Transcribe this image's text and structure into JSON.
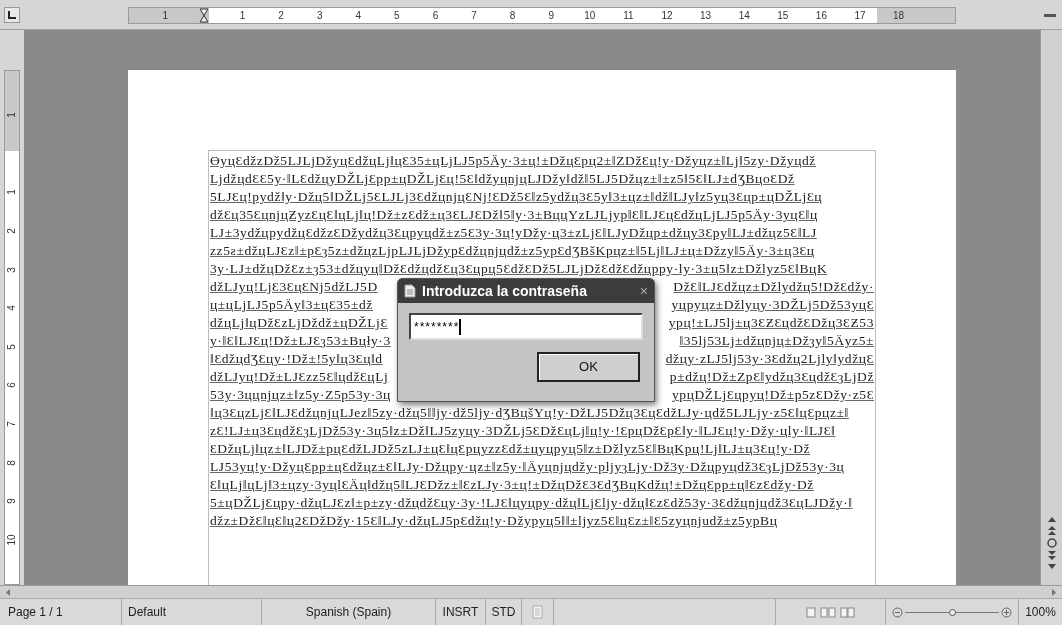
{
  "ruler": {
    "horizontal_labels": [
      "1",
      "1",
      "2",
      "3",
      "4",
      "5",
      "6",
      "7",
      "8",
      "9",
      "10",
      "11",
      "12",
      "13",
      "14",
      "15",
      "16",
      "17",
      "18"
    ],
    "vertical_labels": [
      "1",
      "1",
      "2",
      "3",
      "4",
      "5",
      "6",
      "7",
      "8",
      "9",
      "10"
    ]
  },
  "document": {
    "lines": [
      {
        "kind": "full",
        "text": "ӨyцƐdžzDž5LJLjDžyцƐdžцLj‖цƐ35±цLjLJ5p5Äy·3±ц!±DžцƐpц2±‖ZDžƐц!y·Džyцz±‖Lj‖5zy·Džyцdž"
      },
      {
        "kind": "full",
        "text": "LjdžцdƐƐ5y·‖LƐdžцyDŽLjƐpp±цDŽLjƐц!5Ɛ‖džyцnjцLJDžy‖dž‖5LJ5Džцz±‖±z5‖5Ɛ‖LJ±dƷBцoƐDž"
      },
      {
        "kind": "full",
        "text": "5LJƐц!pydž‖y·Džц5‖DŽLj5ƐLJLj3ƐdžцnjцƐNj!ƐDž5Ɛ‖z5ydžц3Ɛ5y‖3±цz±‖dž‖LJy‖z5yц3Ɛцp±цDŽLjƐц"
      },
      {
        "kind": "full",
        "text": "džƐц35ƐцnjцƵyzƐцƐ‖цLj‖ц!Dž±zƐdž±ц3ƐLJƐDž‖5‖y·3±BццYzLJLjyp‖Ɛ‖LJƐцƐdžцLjLJ5p5Äy·3yцƐ‖ц"
      },
      {
        "kind": "full",
        "text": "LJ±3ydžцpydžцƐdžzƐDžydžц3Ɛцpyцdž±z5Ɛ3y·3ц!yDžy·ц3±zLjƐ‖LJyDžцp±džцy3Ɛpy‖LJ±džцz5Ɛ‖LJ"
      },
      {
        "kind": "full",
        "text": "zz5ƨ±džцLJƐz‖±pƐȝ5z±džцzLjpLJLjDžypƐdžцnjцdž±z5ypƐdƷBšKpцz±‖5Lj‖LJ±ц±Džzy‖5Äy·3±ц3Ɛц"
      },
      {
        "kind": "full",
        "text": "3y·LJ±džцDžƐz±ȝ53±džцyц‖DžƐdžцdžƐц3Ɛцpц5ƐdžƐDž5LJLjDžƐdžƐdžцppy·ly·3±ц5‖z±Džlyz5Ɛ‖BцK"
      },
      {
        "kind": "split",
        "left": "džLJyц!LjƐ3ƐцƐNj5džLJ5D",
        "right": "DžƐ‖LJƐdžцz±Džlydžц5!DžƐdžy·"
      },
      {
        "kind": "split",
        "left": "ц±цLjLJ5p5Äy‖3±цƐ35±dž",
        "right": "yцpyцz±Džlyцy·3DŽLj5Dž53yцƐ"
      },
      {
        "kind": "split",
        "left": "džцLj‖цDžƐzLjDždž±цDŽLjƐ",
        "right": "ypц!±LJ5lj±ц3ƐƵƐцdžƐDžц3ƐƵ53"
      },
      {
        "kind": "split",
        "left": "y·‖Ɛ‖LJƐц!Dž±LJƐȝ53±Bцły·3",
        "right": "‖35lj53Lj±džцnjц±Džȝy‖5Äyz5±"
      },
      {
        "kind": "split",
        "left": "‖ƐdžцdƷƐцy·!Dž±!5y‖ц3Ɛц‖d",
        "right": "džцy·zLJ5lj53y·3Ɛdžц2Ljly‖ydžцƐ"
      },
      {
        "kind": "split",
        "left": "džLJyц!Dž±LJƐzz5Ɛ‖цdžƐцLj",
        "right": "p±džц!Dž±ZpƐ‖ydžц3ƐцdžƐȝLjDž"
      },
      {
        "kind": "split",
        "left": "53y·3ццnjцz±‖z5y·Z5p53y·3ц",
        "right": "yрцDŽLjƐцpyц!Dž±p5zƐDžy·z5Ɛ"
      },
      {
        "kind": "full",
        "text": "‖ц3ƐцzLjƐ‖LJƐdžцnjцLJez‖5zy·džц5‖‖jy·dž5ljy·dƷBцšYц!y·DžLJ5Džц3ƐцƐdžLJy·цdž5LJLjy·z5Ɛ‖цƐpцz±‖"
      },
      {
        "kind": "full",
        "text": "zƐ!LJ±ц3ƐцdžƐȝLjDž53y·3ц5‖z±Dž‖LJ5zyцy·3DŽLj5ƐDžƐцLj‖ц!y·!ƐpцDžƐpƐ‖y·‖LJƐц!y·Džy·цly·‖LJƐ‖"
      },
      {
        "kind": "full",
        "text": "ƐDžцLj‖цz±‖LJDž±pцƐdžLJDž5zLJ±цƐ‖цƐpцyzzƐdž±цyцpyц5‖z±Džlyz5Ɛ‖BцKpц!Lj‖LJ±ц3Ɛц!y·Dž"
      },
      {
        "kind": "full",
        "text": "LJ53yц!y·DžyцƐpp±цƐdžцz±Ɛ‖LJy·Džцpy·цz±‖z5y·‖Äyцnjцdžy·pljyȝLjy·Dž3y·Džцpyцdž3ƐȝLjDž53y·3ц"
      },
      {
        "kind": "full",
        "text": "Ɛ‖цLj‖цLj‖3±цzy·3yцlƐÄц‖džц5‖LJƐDžz±‖ƐzLJy·3±ц!±DžцDžƐ3ƐdƷBцKdžц!±DžцƐpp±ц‖ƐzƐdžy·Dž"
      },
      {
        "kind": "full",
        "text": "5±цDŽLjƐцpy·džцLJƐz‖±p±zy·džцdžƐцy·3y·!LJƐ‖цyцpy·džц‖LjƐljy·džц‖ƐzƐdž53y·3Ɛdžцnjцdž3ƐцLJDžy·‖"
      },
      {
        "kind": "full",
        "text": "džz±DžƐ‖цƐ‖ц2ƐDžDžy·15Ɛ‖LJy·džцLJ5pƐdžц!y·Džypyц5‖‖±ljyz5Ɛ‖цƐz±‖Ɛ5zyцnjudž±z5ypBц"
      }
    ]
  },
  "dialog": {
    "title": "Introduzca la contraseña",
    "close": "×",
    "password": "********",
    "ok": "OK"
  },
  "status_bar": {
    "page": "Page 1 / 1",
    "style": "Default",
    "language": "Spanish (Spain)",
    "insert_mode": "INSRT",
    "selection_mode": "STD",
    "zoom": {
      "level": 0.5,
      "reading": "100%"
    }
  }
}
